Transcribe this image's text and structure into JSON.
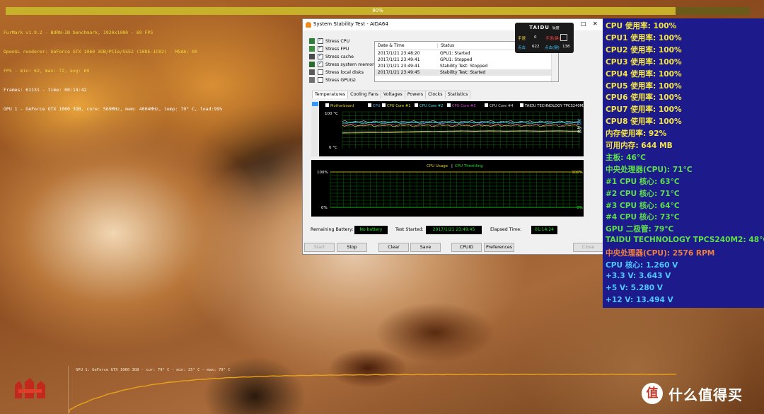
{
  "furmark": {
    "progress_text": "90%",
    "progress_fraction": 0.9,
    "info": [
      "FurMark v1.9.2 - BURN-IN benchmark, 1920x1080 - 69 FPS",
      "OpenGL renderer: GeForce GTX 1060 3GB/PCIe/SSE2 (10DE-1C02) - MSAA: 0X",
      "FPS - min: 62, max: 72, avg: 69",
      "Frames: 61131 - time: 00:14:42",
      "GPU 1 - GeForce GTX 1060 3GB, core: 569MHz, mem: 4004MHz, temp: 79° C, load:99%"
    ],
    "graph_label": "GPU 1: GeForce GTX 1060 3GB - cur: 79° C - min: 25° C - max: 79° C",
    "graph_color": "#e8a21a"
  },
  "aida": {
    "title": "System Stability Test - AIDA64",
    "max_glyph": "□",
    "close_glyph": "✕",
    "stress_options": [
      {
        "label": "Stress CPU",
        "checked": true,
        "icon": "cpu-icon"
      },
      {
        "label": "Stress FPU",
        "checked": true,
        "icon": "fpu-icon"
      },
      {
        "label": "Stress cache",
        "checked": true,
        "icon": "cache-icon"
      },
      {
        "label": "Stress system memory",
        "checked": true,
        "icon": "memory-icon"
      },
      {
        "label": "Stress local disks",
        "checked": false,
        "icon": "disk-icon"
      },
      {
        "label": "Stress GPU(s)",
        "checked": false,
        "icon": "gpu-icon"
      }
    ],
    "log": {
      "headers": [
        "Date & Time",
        "Status"
      ],
      "rows": [
        [
          "2017/1/21 23:48:20",
          "GPU1: Started"
        ],
        [
          "2017/1/21 23:49:41",
          "GPU1: Stopped"
        ],
        [
          "2017/1/21 23:49:41",
          "Stability Test: Stopped"
        ],
        [
          "2017/1/21 23:49:45",
          "Stability Test: Started"
        ]
      ]
    },
    "tabs": [
      "Temperatures",
      "Cooling Fans",
      "Voltages",
      "Powers",
      "Clocks",
      "Statistics"
    ],
    "active_tab": "Temperatures",
    "temp_legend": [
      {
        "label": "Motherboard",
        "color": "#e8d020"
      },
      {
        "label": "CPU",
        "color": "#5ab0ff"
      },
      {
        "label": "CPU Core #1",
        "color": "#e8e820"
      },
      {
        "label": "CPU Core #2",
        "color": "#40e0e0"
      },
      {
        "label": "CPU Core #3",
        "color": "#e040e0"
      },
      {
        "label": "CPU Core #4",
        "color": "#d0d0d0"
      },
      {
        "label": "TAIDU TECHNOLOGY TPCS240M2",
        "color": "#ffffff"
      }
    ],
    "temp_axis": {
      "top": "100 °C",
      "bottom": "0 °C"
    },
    "temp_right_labels": [
      "72",
      "63",
      "48",
      "46"
    ],
    "temp_series": [
      {
        "name": "CPU Core #4",
        "value": 73,
        "color": "#d0d0d0"
      },
      {
        "name": "CPU",
        "value": 71,
        "color": "#5ab0ff"
      },
      {
        "name": "CPU Core #2",
        "value": 71,
        "color": "#40e0e0"
      },
      {
        "name": "CPU Core #3",
        "value": 64,
        "color": "#e040e0"
      },
      {
        "name": "CPU Core #1",
        "value": 63,
        "color": "#e8e820"
      },
      {
        "name": "TAIDU TECHNOLOGY TPCS240M2",
        "value": 48,
        "color": "#ffffff"
      },
      {
        "name": "Motherboard",
        "value": 46,
        "color": "#e8d020"
      }
    ],
    "usage_legend": {
      "usage": "CPU Usage",
      "sep": "|",
      "throttle": "CPU Throttling",
      "usage_color": "#e8d020",
      "throttle_color": "#1ee01e"
    },
    "usage_axis": {
      "top": "100%",
      "bottom": "0%"
    },
    "usage_value": 100,
    "throttle_value": 0,
    "status": {
      "battery_label": "Remaining Battery:",
      "battery_value": "No battery",
      "started_label": "Test Started:",
      "started_value": "2017/1/21 23:49:45",
      "elapsed_label": "Elapsed Time:",
      "elapsed_value": "01:14:24"
    },
    "buttons": {
      "start": "Start",
      "stop": "Stop",
      "clear": "Clear",
      "save": "Save",
      "cpuid": "CPUID",
      "preferences": "Preferences",
      "close": "Close"
    }
  },
  "taidu": {
    "brand": "TAIDU",
    "brand_sub": "钛度",
    "auto_label": "手速",
    "auto_value": "0",
    "speed_label": "手速(键)",
    "clicks_label": "点击",
    "clicks_value": "622",
    "keys_label": "点击(键)",
    "keys_value": "138"
  },
  "sensors": [
    {
      "text": "CPU 使用率: 100%",
      "color": "#f5e642"
    },
    {
      "text": "CPU1 使用率: 100%",
      "color": "#f5e642"
    },
    {
      "text": "CPU2 使用率: 100%",
      "color": "#f5e642"
    },
    {
      "text": "CPU3 使用率: 100%",
      "color": "#f5e642"
    },
    {
      "text": "CPU4 使用率: 100%",
      "color": "#f5e642"
    },
    {
      "text": "CPU5 使用率: 100%",
      "color": "#f5e642"
    },
    {
      "text": "CPU6 使用率: 100%",
      "color": "#f5e642"
    },
    {
      "text": "CPU7 使用率: 100%",
      "color": "#f5e642"
    },
    {
      "text": "CPU8 使用率: 100%",
      "color": "#f5e642"
    },
    {
      "text": "内存使用率: 92%",
      "color": "#f5e642"
    },
    {
      "text": "可用内存: 644 MB",
      "color": "#f5e642"
    },
    {
      "text": "主板: 46°C",
      "color": "#5fe04a"
    },
    {
      "text": "中央处理器(CPU): 71°C",
      "color": "#5fe04a"
    },
    {
      "text": " #1 CPU 核心: 63°C",
      "color": "#5fe04a"
    },
    {
      "text": " #2 CPU 核心: 71°C",
      "color": "#5fe04a"
    },
    {
      "text": " #3 CPU 核心: 64°C",
      "color": "#5fe04a"
    },
    {
      "text": " #4 CPU 核心: 73°C",
      "color": "#5fe04a"
    },
    {
      "text": "GPU 二极管: 79°C",
      "color": "#5fe04a"
    },
    {
      "text": "TAIDU TECHNOLOGY TPCS240M2: 48°C",
      "color": "#5fe04a"
    },
    {
      "text": "中央处理器(CPU): 2576 RPM",
      "color": "#f08040"
    },
    {
      "text": "CPU 核心: 1.260 V",
      "color": "#50c8ff"
    },
    {
      "text": "+3.3 V: 3.643 V",
      "color": "#50c8ff"
    },
    {
      "text": "+5 V: 5.280 V",
      "color": "#50c8ff"
    },
    {
      "text": "+12 V: 13.494 V",
      "color": "#50c8ff"
    }
  ],
  "watermark": {
    "glyph": "值",
    "text": "什么值得买"
  }
}
